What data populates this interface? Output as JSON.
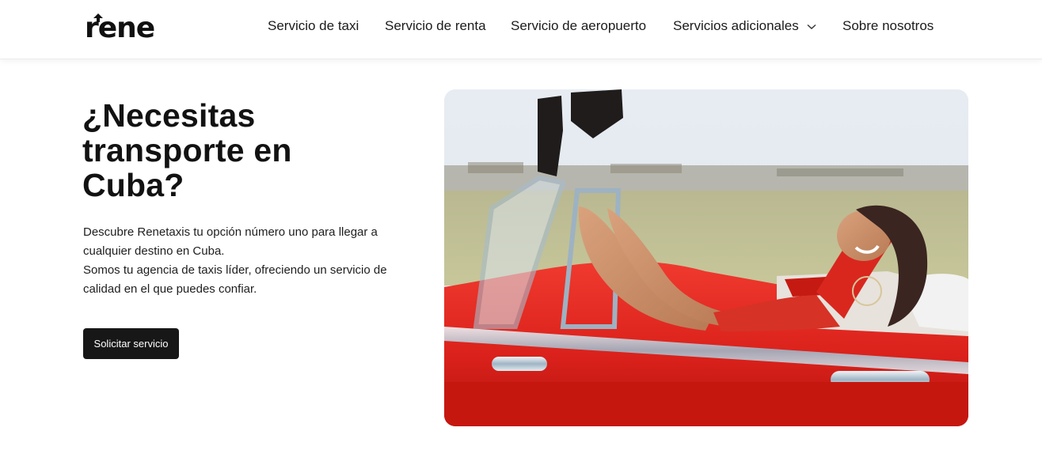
{
  "brand": {
    "logo_text": "rene"
  },
  "nav": {
    "items": [
      {
        "label": "Servicio de taxi"
      },
      {
        "label": "Servicio de renta"
      },
      {
        "label": "Servicio de aeropuerto"
      },
      {
        "label": "Servicios adicionales",
        "icon": "chevron-down-icon"
      },
      {
        "label": "Sobre nosotros"
      }
    ]
  },
  "hero": {
    "title": "¿Necesitas transporte en Cuba?",
    "paragraph_1": "Descubre Renetaxis tu opción número uno para llegar a cualquier destino en Cuba.",
    "paragraph_2": "Somos tu agencia de taxis líder, ofreciendo un servicio de calidad en el que puedes confiar.",
    "cta_label": "Solicitar servicio"
  },
  "colors": {
    "accent": "#171717",
    "car_red": "#e3251f"
  }
}
